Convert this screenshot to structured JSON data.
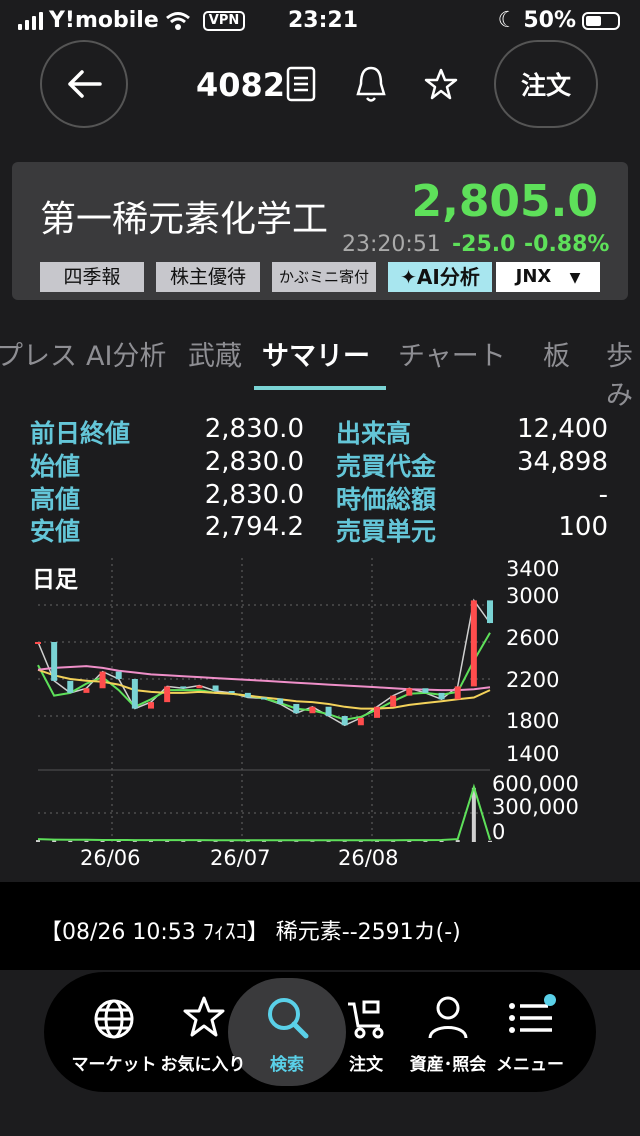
{
  "status_bar": {
    "carrier": "Y!mobile",
    "vpn": "VPN",
    "time": "23:21",
    "battery": "50%"
  },
  "header": {
    "code": "4082",
    "order_label": "注文"
  },
  "quote": {
    "name": "第一稀元素化学工",
    "price": "2,805.0",
    "time": "23:20:51",
    "change": "-25.0",
    "change_pct": "-0.88%",
    "buttons": [
      "四季報",
      "株主優待",
      "かぶミニ寄付",
      "✦AI分析"
    ],
    "market": "JNX",
    "up_color": "#5ee05a"
  },
  "tabs": [
    "プレス",
    "AI分析",
    "武蔵",
    "サマリー",
    "チャート",
    "板",
    "歩み"
  ],
  "active_tab": "サマリー",
  "stats": {
    "left": [
      {
        "label": "前日終値",
        "value": "2,830.0"
      },
      {
        "label": "始値",
        "value": "2,830.0"
      },
      {
        "label": "高値",
        "value": "2,830.0"
      },
      {
        "label": "安値",
        "value": "2,794.2"
      }
    ],
    "right": [
      {
        "label": "出来高",
        "value": "12,400"
      },
      {
        "label": "売買代金",
        "value": "34,898"
      },
      {
        "label": "時価総額",
        "value": "-"
      },
      {
        "label": "売買単元",
        "value": "100"
      }
    ]
  },
  "chart_data": {
    "type": "line",
    "title": "日足",
    "x_ticks": [
      "26/06",
      "26/07",
      "26/08"
    ],
    "price_ticks": [
      "3400",
      "3000",
      "2600",
      "2200",
      "1800",
      "1400"
    ],
    "price_ylim": [
      1400,
      3400
    ],
    "volume_ticks": [
      "600,000",
      "300,000",
      "0"
    ],
    "volume_ylim": [
      0,
      600000
    ],
    "x": [
      0,
      3,
      6,
      9,
      12,
      15,
      18,
      21,
      24,
      27,
      30,
      33,
      36,
      39,
      42,
      45,
      48,
      51,
      54,
      57,
      60,
      63,
      66,
      69,
      72,
      75,
      78,
      81,
      84
    ],
    "series": [
      {
        "color": "#d0d0d0",
        "values": [
          2600,
          2180,
          2050,
          2100,
          2280,
          2200,
          1880,
          1950,
          2120,
          2100,
          2130,
          2070,
          2050,
          2000,
          1990,
          1930,
          1830,
          1900,
          1800,
          1700,
          1780,
          1900,
          2020,
          2100,
          2050,
          1980,
          2120,
          3050,
          2805
        ]
      },
      {
        "color": "#5ee05a",
        "values": [
          2350,
          2020,
          2050,
          2150,
          2220,
          2080,
          1900,
          1980,
          2080,
          2080,
          2080,
          2050,
          2040,
          2020,
          1990,
          1940,
          1880,
          1860,
          1820,
          1760,
          1790,
          1870,
          1960,
          2040,
          2050,
          2030,
          2060,
          2400,
          2700
        ]
      },
      {
        "color": "#f3d25a",
        "values": [
          2300,
          2240,
          2200,
          2180,
          2170,
          2140,
          2080,
          2060,
          2050,
          2050,
          2060,
          2050,
          2040,
          2020,
          2000,
          1980,
          1960,
          1950,
          1930,
          1900,
          1880,
          1880,
          1890,
          1920,
          1940,
          1960,
          1980,
          2000,
          2080
        ]
      },
      {
        "color": "#ef8fc9",
        "values": [
          2300,
          2320,
          2330,
          2340,
          2320,
          2290,
          2270,
          2250,
          2240,
          2230,
          2220,
          2210,
          2200,
          2190,
          2180,
          2170,
          2160,
          2150,
          2140,
          2130,
          2120,
          2110,
          2100,
          2090,
          2085,
          2080,
          2080,
          2090,
          2110
        ]
      }
    ],
    "volume": [
      20000,
      15000,
      12000,
      12000,
      10000,
      10000,
      9000,
      9000,
      9000,
      9000,
      9000,
      8000,
      8000,
      8000,
      8000,
      7000,
      7000,
      7000,
      7000,
      7000,
      7000,
      8000,
      8000,
      9000,
      9000,
      10000,
      20000,
      560000,
      12400
    ]
  },
  "news": {
    "text": "【08/26 10:53 ﾌｨｽｺ】 稀元素--2591カ(-)"
  },
  "nav": [
    {
      "label": "マーケット",
      "icon": "globe-icon"
    },
    {
      "label": "お気に入り",
      "icon": "star-icon"
    },
    {
      "label": "検索",
      "icon": "search-icon"
    },
    {
      "label": "注文",
      "icon": "cart-icon"
    },
    {
      "label": "資産･照会",
      "icon": "person-icon"
    },
    {
      "label": "メニュー",
      "icon": "menu-icon"
    }
  ],
  "nav_active": "検索"
}
